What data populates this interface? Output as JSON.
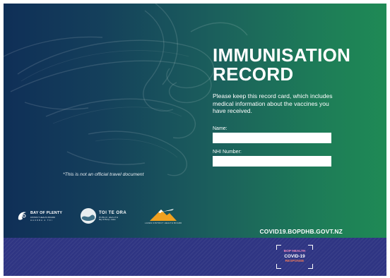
{
  "card": {
    "title_line1": "IMMUNISATION",
    "title_line2": "RECORD",
    "intro": "Please keep this record card, which includes medical information about the vaccines you have received.",
    "fields": {
      "name_label": "Name:",
      "name_value": "",
      "nhi_label": "NHI Number:",
      "nhi_value": ""
    },
    "disclaimer": "*This is not an official travel document",
    "website": "COVID19.BOPDHB.GOVT.NZ"
  },
  "logos": {
    "bop": {
      "name": "BAY OF PLENTY",
      "sub": "DISTRICT HEALTH BOARD",
      "sub2": "HAUORA A TOI"
    },
    "toi": {
      "name": "TOI TE ORA",
      "sub": "PUBLIC HEALTH",
      "sub2": "Bay of Plenty • Lakes"
    },
    "lakes": {
      "name": "LAKES DISTRICT HEALTH BOARD"
    }
  },
  "badge": {
    "line1": "BOP HEALTH",
    "line2": "COVID-19",
    "line3": "RESPONSE"
  },
  "colors": {
    "gradient_left": "#0f2f57",
    "gradient_right": "#1f8a55",
    "band": "#2f3583",
    "badge_pink": "#f08ac0",
    "badge_orange": "#f07a5a"
  },
  "icons": [
    "koru-pattern",
    "bop-logo-icon",
    "toi-te-ora-logo-icon",
    "lakes-mountain-logo-icon"
  ]
}
